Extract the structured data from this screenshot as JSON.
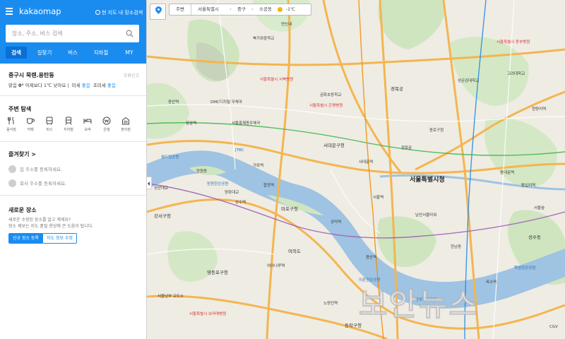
{
  "app": {
    "logo_text": "kakaomap",
    "search_here_label": "현 지도 내 장소검색"
  },
  "search": {
    "placeholder": "장소, 주소, 버스 검색"
  },
  "tabs": [
    "검색",
    "길찾기",
    "버스",
    "지하철",
    "MY"
  ],
  "active_tab": "검색",
  "weather": {
    "place": "중구시 묵렌.용탄동",
    "report_link": "오류신고",
    "condition": "맑음",
    "temperature": "0°",
    "compare": "어제보다 1℃ 낮아요",
    "fine_dust_label": "미세",
    "fine_dust_value": "좋음",
    "ultrafine_dust_label": "초미세",
    "ultrafine_dust_value": "좋음"
  },
  "around": {
    "title": "주변 탐색",
    "categories": [
      "음식점",
      "카페",
      "버스",
      "지하철",
      "숙박",
      "은행",
      "편의점"
    ]
  },
  "favorites": {
    "title": "즐겨찾기 >",
    "home": "집 주소를 등록하세요.",
    "office": "회사 주소를 등록하세요."
  },
  "new_place": {
    "title": "새로운 장소",
    "desc_line1": "새로운 수정된 장소를 알고 계세요?",
    "desc_line2": "장소 제보는 지도 품질 향상에 큰 도움이 됩니다.",
    "register_button": "신규 장소 등록",
    "fix_button": "지도 정보 수정"
  },
  "map": {
    "breadcrumb": {
      "around": "주변",
      "items": [
        "서울특별시",
        "중구",
        "소공동"
      ],
      "temperature": "-1℃"
    },
    "labels": {
      "city_hall": "서울특별시청",
      "l1": "북가좌중학교",
      "l2": "연신내",
      "l3": "서울특별시 서북병원",
      "l4": "응암역",
      "l5": "DMC디지털 우체국",
      "l6": "증산역",
      "l7": "서울홍제동우체국",
      "l8": "서울특별시 은평병원",
      "l9": "금화초등학교",
      "l10": "서대문구청",
      "l11": "JTBC",
      "l12": "가좌역",
      "l13": "망원동",
      "l14": "합정역",
      "l15": "망원한강공원",
      "l16": "서대문역",
      "l17": "경복궁",
      "l18": "광화문",
      "l19": "성균관대학교",
      "l20": "종로구청",
      "l21": "동대문역",
      "l22": "마포구청",
      "l23": "공덕역",
      "l24": "여의도",
      "l25": "여의나루역",
      "l26": "노량진역",
      "l27": "용산역",
      "l28": "이촌한강공원",
      "l29": "서울역",
      "l30": "남산서울타워",
      "l31": "한남동",
      "l32": "강서구청",
      "l33": "서울남부 교도소",
      "l34": "동작구청",
      "l35": "반포한강공원",
      "l36": "상수역",
      "l37": "양화대교",
      "l38": "성산대교",
      "l39": "월드컵공원",
      "l40": "영등포구청",
      "l41": "서울특별시 보라매병원",
      "l42": "옥수역",
      "l43": "성수동",
      "l44": "뚝섬한강공원",
      "l45": "서울숲",
      "l46": "왕십리역",
      "l47": "청량리역",
      "l48": "고려대학교",
      "l49": "CGV",
      "l50": "서울특별시 동부병원"
    },
    "watermark": "보안뉴스"
  }
}
